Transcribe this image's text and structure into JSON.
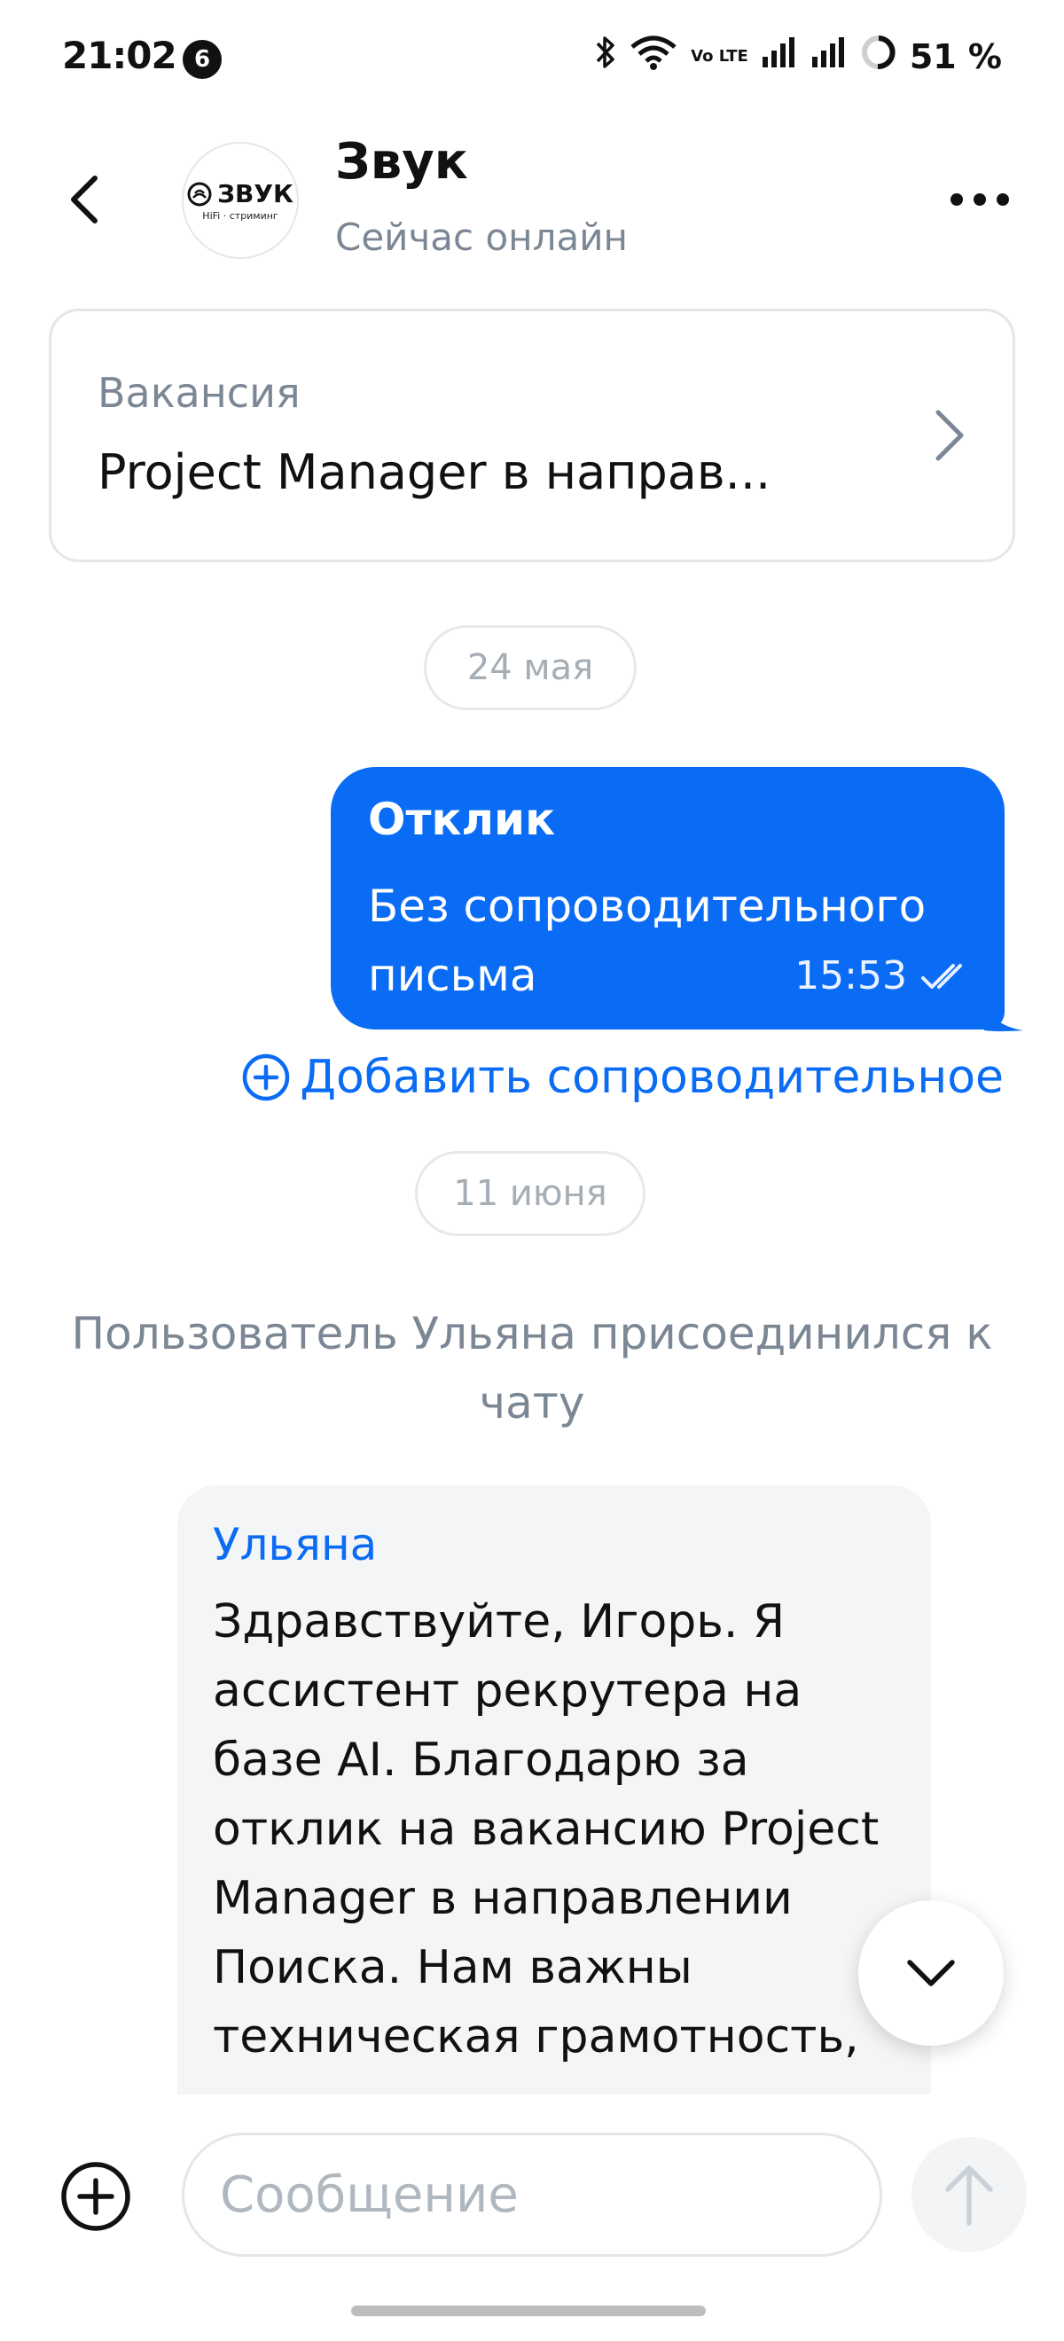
{
  "status_bar": {
    "time": "21:02",
    "notification_count": "6",
    "volte": "Vo LTE",
    "battery": "51 %"
  },
  "header": {
    "avatar_brand": "ЗВУК",
    "avatar_subtitle": "HiFi · стриминг",
    "title": "Звук",
    "status": "Сейчас онлайн"
  },
  "vacancy": {
    "label": "Вакансия",
    "name": "Project Manager в направ..."
  },
  "messages": {
    "date_1": "24 мая",
    "outgoing": {
      "title": "Отклик",
      "text": "Без сопроводительного письма",
      "time": "15:53"
    },
    "add_cover_letter": "Добавить сопроводительное",
    "date_2": "11 июня",
    "system": "Пользователь Ульяна присоединился к чату",
    "incoming": {
      "sender": "Ульяна",
      "text": "Здравствуйте, Игорь. Я ассистент рекрутера на базе AI. Благодарю за отклик на вакансию Project Manager в направлении Поиска. Нам важны техническая грамотность,"
    }
  },
  "composer": {
    "placeholder": "Сообщение"
  },
  "colors": {
    "accent": "#0a6cf5",
    "muted": "#7b8794",
    "incoming_bg": "#f4f5f6"
  }
}
